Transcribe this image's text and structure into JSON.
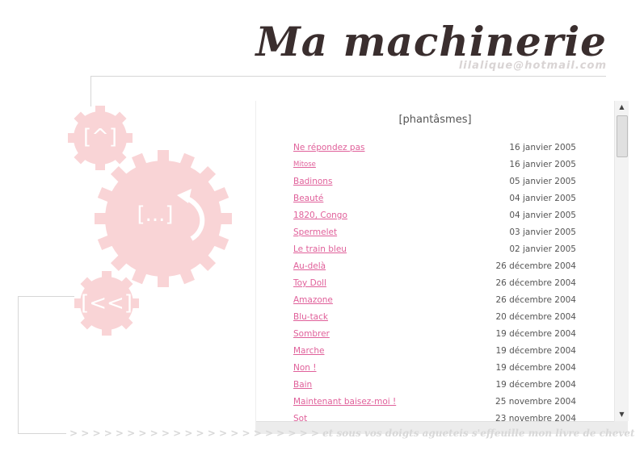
{
  "header": {
    "title": "Ma machinerie",
    "email": "lilalique@hotmail.com"
  },
  "nav": {
    "top_label": "[^]",
    "center_label": "[...]",
    "back_label": "[<<]"
  },
  "colors": {
    "gear_pink": "#f9d4d6",
    "link_pink": "#e0609a",
    "title_dark": "#3a2e2e",
    "line_grey": "#d6d6d6"
  },
  "main": {
    "section_title": "[phantâsmes]",
    "entries": [
      {
        "title": "Ne répondez pas",
        "date": "16 janvier 2005"
      },
      {
        "title": "Mitose",
        "date": "16 janvier 2005"
      },
      {
        "title": "Badinons",
        "date": "05 janvier 2005"
      },
      {
        "title": "Beauté",
        "date": "04 janvier 2005"
      },
      {
        "title": "1820, Congo",
        "date": "04 janvier 2005"
      },
      {
        "title": "Spermelet",
        "date": "03 janvier 2005"
      },
      {
        "title": "Le train bleu",
        "date": "02 janvier 2005"
      },
      {
        "title": "Au-delà",
        "date": "26 décembre 2004"
      },
      {
        "title": "Toy Doll",
        "date": "26 décembre 2004"
      },
      {
        "title": "Amazone",
        "date": "26 décembre 2004"
      },
      {
        "title": "Blu-tack",
        "date": "20 décembre 2004"
      },
      {
        "title": "Sombrer",
        "date": "19 décembre 2004"
      },
      {
        "title": "Marche",
        "date": "19 décembre 2004"
      },
      {
        "title": "Non !",
        "date": "19 décembre 2004"
      },
      {
        "title": "Bain",
        "date": "19 décembre 2004"
      },
      {
        "title": "Maintenant baisez-moi !",
        "date": "25 novembre 2004"
      },
      {
        "title": "Sot",
        "date": "23 novembre 2004"
      }
    ]
  },
  "footer": {
    "arrows": "> > > > > > > > > > > > > > > > > > > > > >",
    "tagline": "et sous vos doigts agueteis s'effeuille mon livre de chevet"
  },
  "scrollbar": {
    "up": "▲",
    "down": "▼"
  }
}
